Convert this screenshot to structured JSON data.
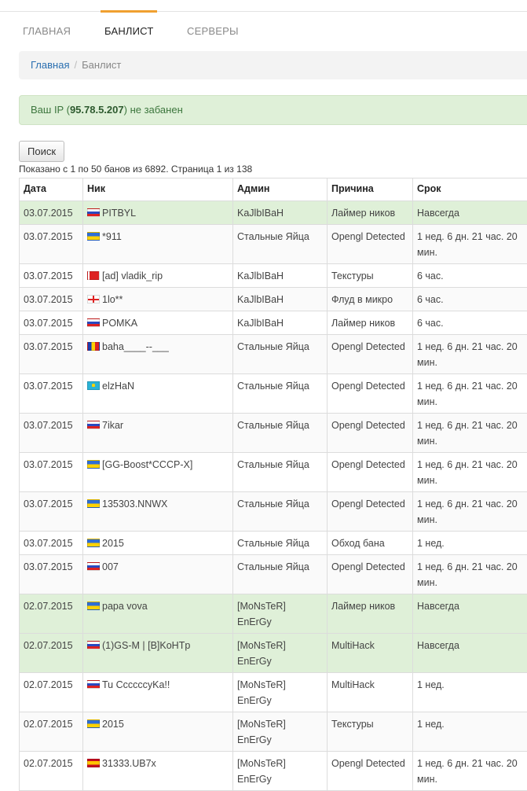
{
  "nav": {
    "items": [
      {
        "label": "ГЛАВНАЯ"
      },
      {
        "label": "БАНЛИСТ"
      },
      {
        "label": "СЕРВЕРЫ"
      }
    ]
  },
  "breadcrumb": {
    "home": "Главная",
    "separator": "/",
    "current": "Банлист"
  },
  "alert": {
    "prefix": "Ваш IP (",
    "ip": "95.78.5.207",
    "suffix": ") не забанен"
  },
  "search": {
    "label": "Поиск"
  },
  "summary": "Показано с 1 по 50 банов из 6892. Страница 1 из 138",
  "table": {
    "headers": {
      "date": "Дата",
      "nick": "Ник",
      "admin": "Админ",
      "reason": "Причина",
      "term": "Срок"
    },
    "rows": [
      {
        "date": "03.07.2015",
        "flag": "ru",
        "nick": "PITBYL",
        "admin": "KaJlbIBaH",
        "reason": "Лаймер ников",
        "term": "Навсегда",
        "perm": true
      },
      {
        "date": "03.07.2015",
        "flag": "ua",
        "nick": "*911",
        "admin": "Стальные Яйца",
        "reason": "Opengl Detected",
        "term": "1 нед. 6 дн. 21 час. 20 мин."
      },
      {
        "date": "03.07.2015",
        "flag": "by",
        "nick": "[ad] vladik_rip",
        "admin": "KaJlbIBaH",
        "reason": "Текстуры",
        "term": "6 час."
      },
      {
        "date": "03.07.2015",
        "flag": "ge",
        "nick": "1lo**",
        "admin": "KaJlbIBaH",
        "reason": "Флуд в микро",
        "term": "6 час."
      },
      {
        "date": "03.07.2015",
        "flag": "ru",
        "nick": "POMKA",
        "admin": "KaJlbIBaH",
        "reason": "Лаймер ников",
        "term": "6 час."
      },
      {
        "date": "03.07.2015",
        "flag": "ro",
        "nick": "baha____--___",
        "admin": "Стальные Яйца",
        "reason": "Opengl Detected",
        "term": "1 нед. 6 дн. 21 час. 20 мин."
      },
      {
        "date": "03.07.2015",
        "flag": "kz",
        "nick": "elzHaN",
        "admin": "Стальные Яйца",
        "reason": "Opengl Detected",
        "term": "1 нед. 6 дн. 21 час. 20 мин."
      },
      {
        "date": "03.07.2015",
        "flag": "ru",
        "nick": "7ikar",
        "admin": "Стальные Яйца",
        "reason": "Opengl Detected",
        "term": "1 нед. 6 дн. 21 час. 20 мин."
      },
      {
        "date": "03.07.2015",
        "flag": "ua",
        "nick": "[GG-Boost*CCCP-X]",
        "admin": "Стальные Яйца",
        "reason": "Opengl Detected",
        "term": "1 нед. 6 дн. 21 час. 20 мин."
      },
      {
        "date": "03.07.2015",
        "flag": "ua",
        "nick": "135303.NNWX",
        "admin": "Стальные Яйца",
        "reason": "Opengl Detected",
        "term": "1 нед. 6 дн. 21 час. 20 мин."
      },
      {
        "date": "03.07.2015",
        "flag": "ua",
        "nick": "2015",
        "admin": "Стальные Яйца",
        "reason": "Обход бана",
        "term": "1 нед."
      },
      {
        "date": "03.07.2015",
        "flag": "ru",
        "nick": "007",
        "admin": "Стальные Яйца",
        "reason": "Opengl Detected",
        "term": "1 нед. 6 дн. 21 час. 20 мин."
      },
      {
        "date": "02.07.2015",
        "flag": "ua",
        "nick": "papa vova",
        "admin": "[MoNsTeR] EnErGy",
        "reason": "Лаймер ников",
        "term": "Навсегда",
        "perm": true
      },
      {
        "date": "02.07.2015",
        "flag": "ru",
        "nick": "(1)GS-M | [B]KoHTp",
        "admin": "[MoNsTeR] EnErGy",
        "reason": "MultiHack",
        "term": "Навсегда",
        "perm": true
      },
      {
        "date": "02.07.2015",
        "flag": "ru",
        "nick": "Tu CcccccyKa!!",
        "admin": "[MoNsTeR] EnErGy",
        "reason": "MultiHack",
        "term": "1 нед."
      },
      {
        "date": "02.07.2015",
        "flag": "ua",
        "nick": "2015",
        "admin": "[MoNsTeR] EnErGy",
        "reason": "Текстуры",
        "term": "1 нед."
      },
      {
        "date": "02.07.2015",
        "flag": "es",
        "nick": "31333.UB7x",
        "admin": "[MoNsTeR] EnErGy",
        "reason": "Opengl Detected",
        "term": "1 нед. 6 дн. 21 час. 20 мин."
      }
    ]
  }
}
